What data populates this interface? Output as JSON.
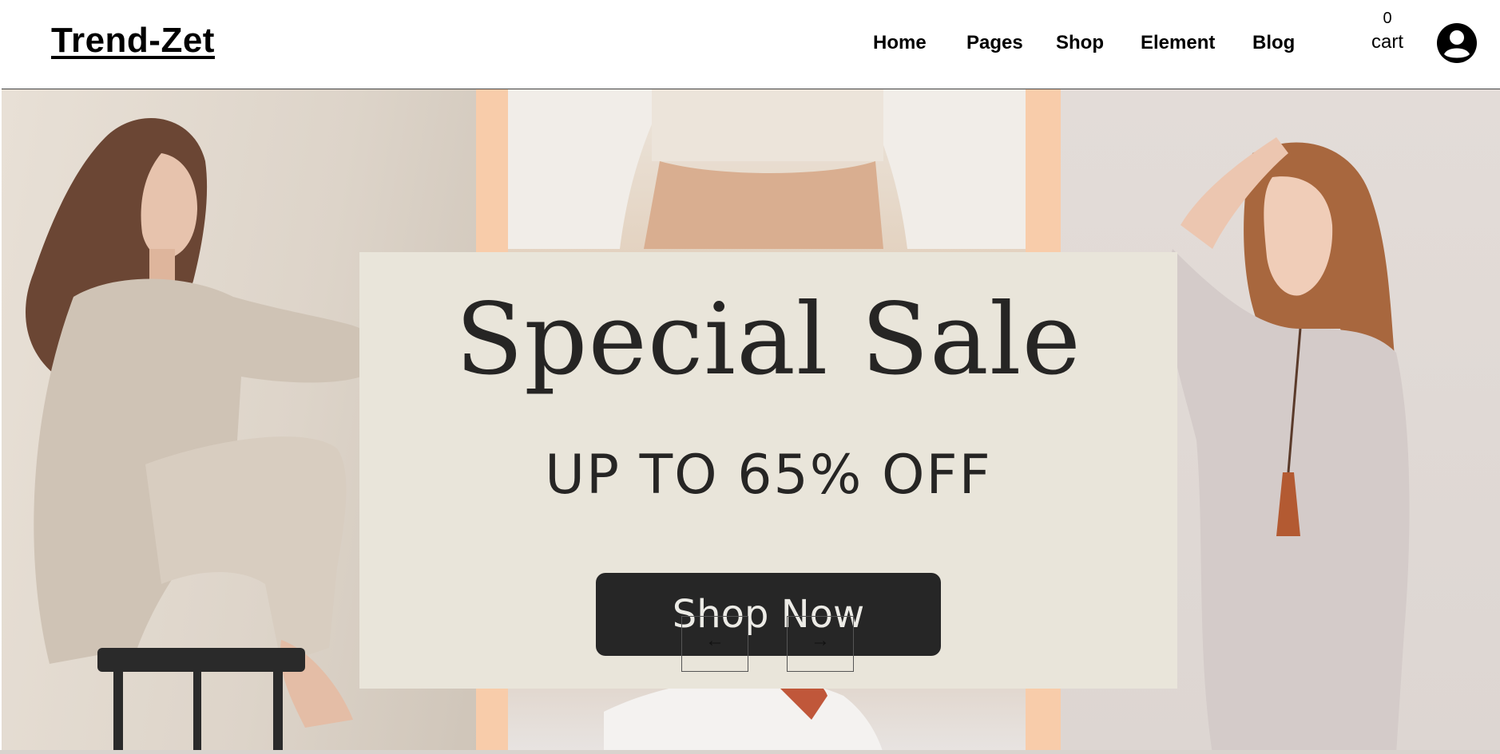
{
  "header": {
    "brand": "Trend-Zet",
    "nav": [
      {
        "label": "Home"
      },
      {
        "label": "Pages"
      },
      {
        "label": "Shop"
      },
      {
        "label": "Element"
      },
      {
        "label": "Blog"
      }
    ],
    "cart": {
      "count": "0",
      "label": "cart"
    },
    "account_icon": "user-circle-icon"
  },
  "hero": {
    "title": "Special Sale",
    "subtitle": "UP TO 65% OFF",
    "cta_label": "Shop Now",
    "prev_icon": "arrow-left-icon",
    "next_icon": "arrow-right-icon",
    "prev_glyph": "←",
    "next_glyph": "→",
    "colors": {
      "card_bg": "#e9e5da",
      "button_bg": "#262626",
      "accent_peach": "#f8ccaa",
      "text_dark": "#262524"
    }
  }
}
